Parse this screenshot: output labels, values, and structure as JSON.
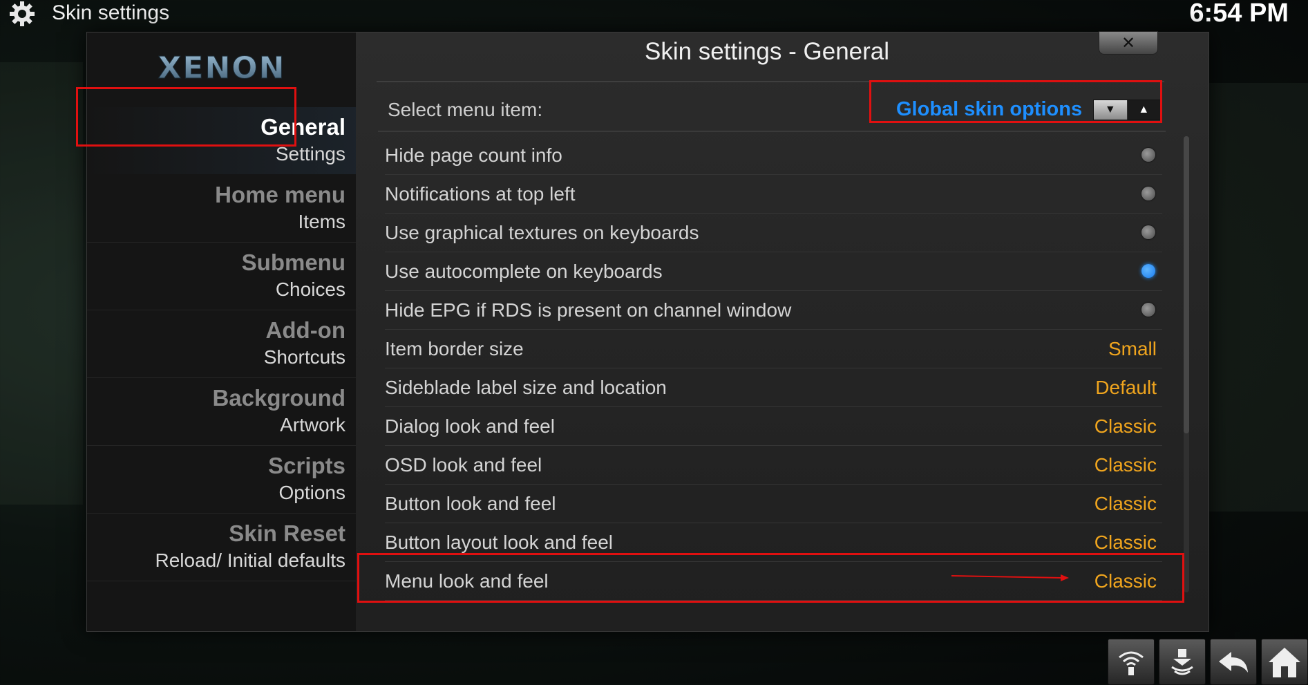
{
  "topbar": {
    "title": "Skin settings",
    "time": "6:54 PM",
    "icon": "gear-icon"
  },
  "logo": {
    "text": "XENON"
  },
  "sidebar": {
    "items": [
      {
        "main": "General",
        "sub": "Settings",
        "active": true
      },
      {
        "main": "Home menu",
        "sub": "Items"
      },
      {
        "main": "Submenu",
        "sub": "Choices"
      },
      {
        "main": "Add-on",
        "sub": "Shortcuts"
      },
      {
        "main": "Background",
        "sub": "Artwork"
      },
      {
        "main": "Scripts",
        "sub": "Options"
      },
      {
        "main": "Skin Reset",
        "sub": "Reload/ Initial defaults"
      }
    ]
  },
  "dialog": {
    "title": "Skin settings - General",
    "close_label": "✕",
    "select_label": "Select menu item:",
    "select_value": "Global skin options",
    "spin_down": "▼",
    "spin_up": "▲"
  },
  "settings": [
    {
      "label": "Hide page count info",
      "type": "toggle",
      "on": false
    },
    {
      "label": "Notifications at top left",
      "type": "toggle",
      "on": false
    },
    {
      "label": "Use graphical textures on keyboards",
      "type": "toggle",
      "on": false
    },
    {
      "label": "Use autocomplete on keyboards",
      "type": "toggle",
      "on": true
    },
    {
      "label": "Hide EPG if RDS is present on channel window",
      "type": "toggle",
      "on": false
    },
    {
      "label": "Item border size",
      "type": "value",
      "value": "Small"
    },
    {
      "label": "Sideblade label size and location",
      "type": "value",
      "value": "Default"
    },
    {
      "label": "Dialog look and feel",
      "type": "value",
      "value": "Classic"
    },
    {
      "label": "OSD look and feel",
      "type": "value",
      "value": "Classic"
    },
    {
      "label": "Button look and feel",
      "type": "value",
      "value": "Classic"
    },
    {
      "label": "Button layout look and feel",
      "type": "value",
      "value": "Classic"
    },
    {
      "label": "Menu look and feel",
      "type": "value",
      "value": "Classic"
    }
  ],
  "bottom_icons": [
    "network-icon",
    "eject-icon",
    "back-icon",
    "home-icon"
  ],
  "colors": {
    "accent_blue": "#1e8fff",
    "value_orange": "#f0a51e",
    "highlight_red": "#e01010"
  }
}
